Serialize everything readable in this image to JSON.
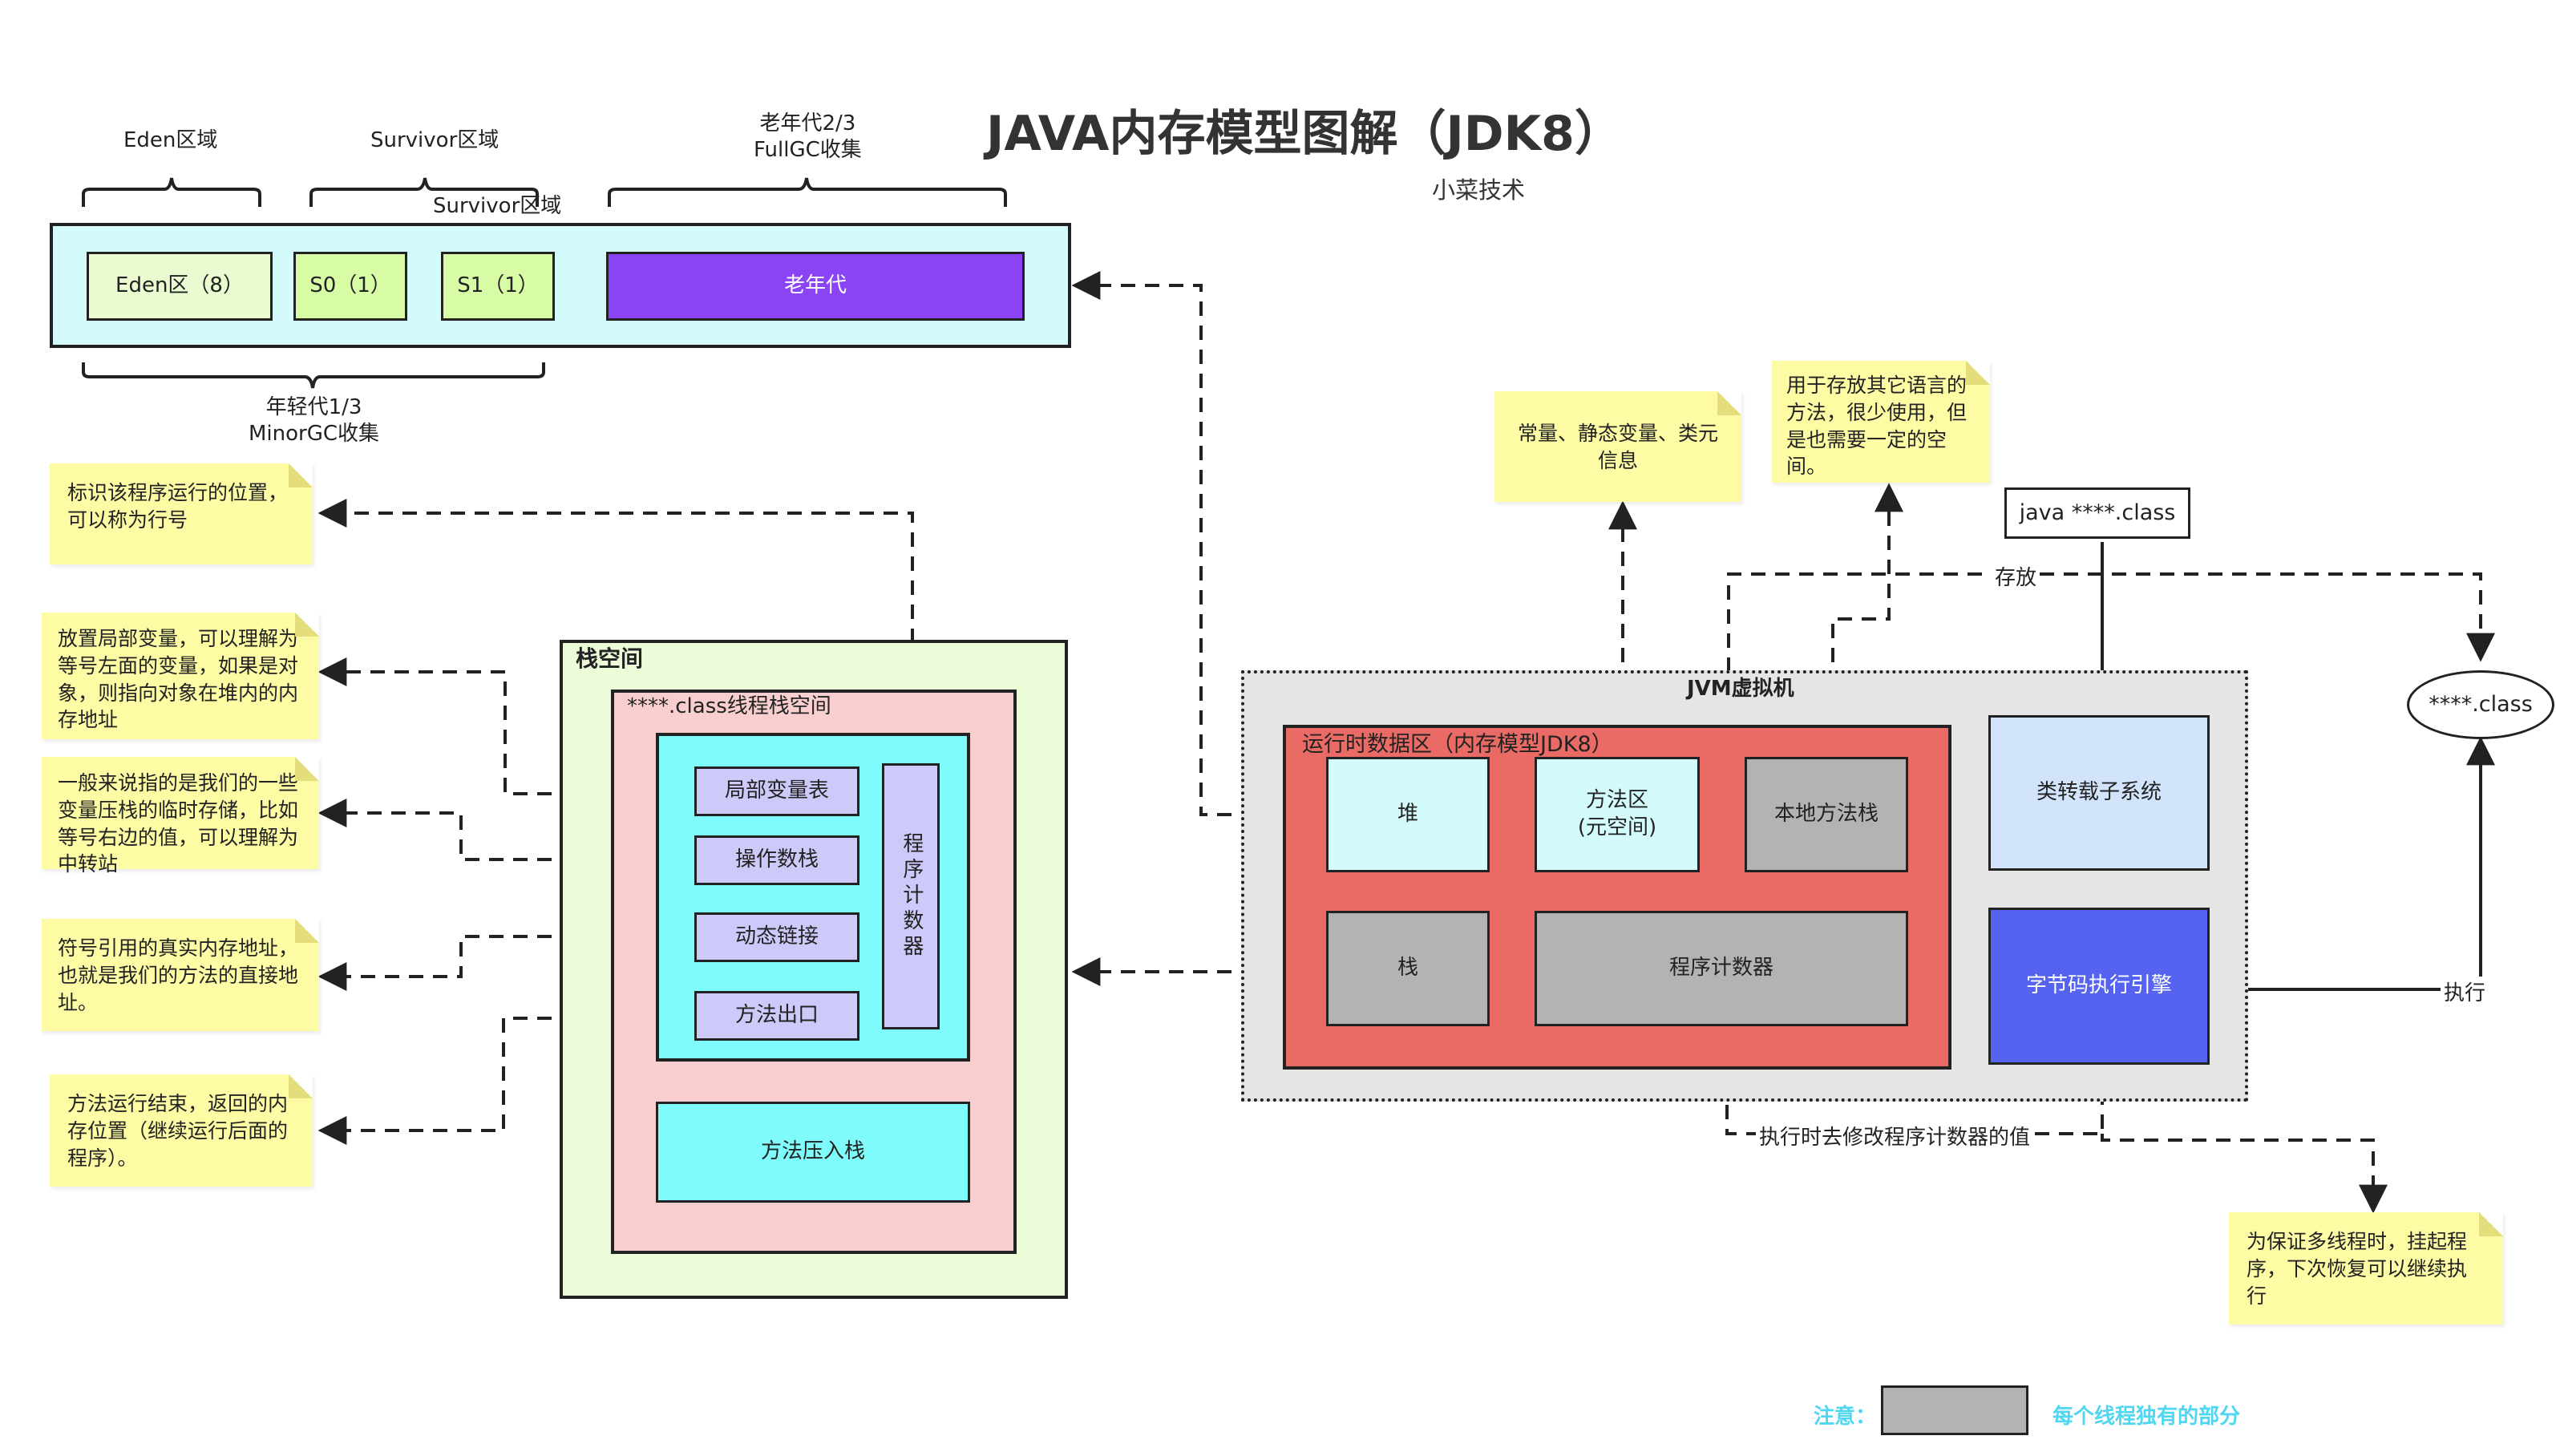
{
  "title": "JAVA内存模型图解（JDK8）",
  "subtitle": "小菜技术",
  "heap": {
    "eden_header": "Eden区域",
    "survivor_header": "Survivor区域",
    "survivor_header2": "Survivor区域",
    "old_header": "老年代2/3\nFullGC收集",
    "eden": "Eden区（8）",
    "s0": "S0（1）",
    "s1": "S1（1）",
    "old": "老年代",
    "young_label": "年轻代1/3\nMinorGC收集"
  },
  "stack_space": {
    "title": "栈空间",
    "thread_title": "****.class线程栈空间",
    "frame_items": [
      "局部变量表",
      "操作数栈",
      "动态链接",
      "方法出口"
    ],
    "pc": "程序计数器",
    "push": "方法压入栈"
  },
  "left_notes": [
    "标识该程序运行的位置，可以称为行号",
    "放置局部变量，可以理解为等号左面的变量，如果是对象，则指向对象在堆内的内存地址",
    "一般来说指的是我们的一些变量压栈的临时存储，比如等号右边的值，可以理解为中转站",
    "符号引用的真实内存地址，也就是我们的方法的直接地址。",
    "方法运行结束，返回的内存位置（继续运行后面的程序）。"
  ],
  "jvm": {
    "title": "JVM虚拟机",
    "runtime_title": "运行时数据区（内存模型JDK8）",
    "heap": "堆",
    "method_area": "方法区\n(元空间)",
    "native_stack": "本地方法栈",
    "stack": "栈",
    "pc": "程序计数器",
    "class_loader": "类转载子系统",
    "engine": "字节码执行引擎"
  },
  "right_notes": {
    "constants": "常量、静态变量、类元信息",
    "native": "用于存放其它语言的方法，很少使用，但是也需要一定的空间。",
    "thread": "为保证多线程时，挂起程序，下次恢复可以继续执行"
  },
  "java_cmd": "java ****.class",
  "class_file": "****.class",
  "edge_labels": {
    "store": "存放",
    "execute": "执行",
    "modify_pc": "执行时去修改程序计数器的值"
  },
  "legend": {
    "note_label": "注意：",
    "desc": "每个线程独有的部分"
  },
  "colors": {
    "heap_bg": "#d4fbfb",
    "eden": "#ebfbd1",
    "survivor": "#d8fba6",
    "old": "#8a44f5",
    "stack_outer": "#edfcd8",
    "stack_thread": "#f8cece",
    "frame": "#7ffbfb",
    "frame_item": "#cdc9f8",
    "runtime": "#ea6b66",
    "private_gray": "#b3b3b3",
    "loader": "#d2e4fb",
    "engine": "#5563f0",
    "note": "#fdfca5",
    "legend_text": "#4fd6f0"
  }
}
